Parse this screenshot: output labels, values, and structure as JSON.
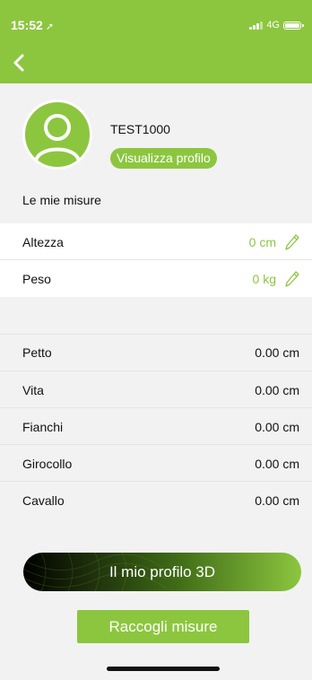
{
  "status_bar": {
    "time": "15:52",
    "network": "4G"
  },
  "profile": {
    "username": "TEST1000",
    "view_profile_label": "Visualizza profilo"
  },
  "section_title": "Le mie misure",
  "editable_measures": [
    {
      "label": "Altezza",
      "value": "0 cm"
    },
    {
      "label": "Peso",
      "value": "0 kg"
    }
  ],
  "measures": [
    {
      "label": "Petto",
      "value": "0.00 cm"
    },
    {
      "label": "Vita",
      "value": "0.00 cm"
    },
    {
      "label": "Fianchi",
      "value": "0.00 cm"
    },
    {
      "label": "Girocollo",
      "value": "0.00 cm"
    },
    {
      "label": "Cavallo",
      "value": "0.00 cm"
    }
  ],
  "buttons": {
    "profile_3d": "Il mio profilo 3D",
    "collect": "Raccogli misure"
  },
  "colors": {
    "accent": "#8cc63f",
    "background": "#f2f2f2"
  },
  "icons": [
    "back-arrow-icon",
    "location-arrow-icon",
    "signal-icon",
    "battery-icon",
    "user-avatar-icon",
    "pencil-icon"
  ]
}
